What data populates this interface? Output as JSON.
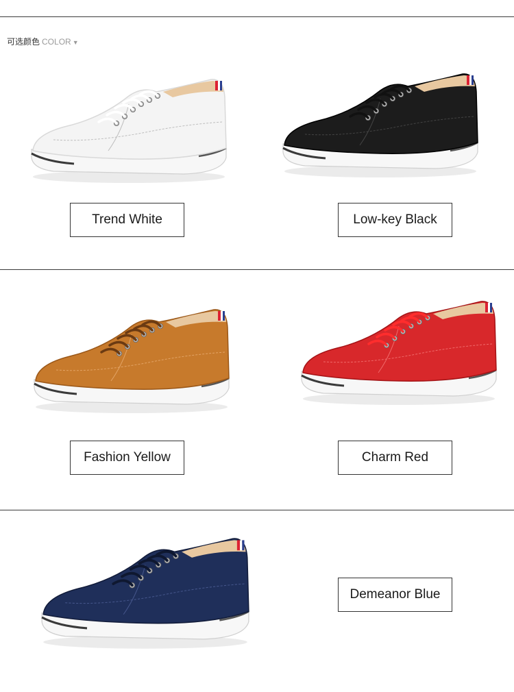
{
  "header": {
    "title_cn": "可选颜色",
    "title_en": "COLOR",
    "caret": "▼"
  },
  "variants": [
    {
      "label": "Trend White",
      "upper": "#f4f4f4",
      "shade": "#d9d9d9",
      "lace": "#ffffff",
      "line": "#bdbdbd"
    },
    {
      "label": "Low-key Black",
      "upper": "#1c1c1c",
      "shade": "#000000",
      "lace": "#111111",
      "line": "#444444"
    },
    {
      "label": "Fashion Yellow",
      "upper": "#c77a2c",
      "shade": "#9a5718",
      "lace": "#6b3a12",
      "line": "#e3a466"
    },
    {
      "label": "Charm Red",
      "upper": "#d8282b",
      "shade": "#a41316",
      "lace": "#ff2d2d",
      "line": "#f06b6b"
    },
    {
      "label": "Demeanor Blue",
      "upper": "#1f2f5a",
      "shade": "#121c3a",
      "lace": "#0f1830",
      "line": "#44558a"
    }
  ]
}
